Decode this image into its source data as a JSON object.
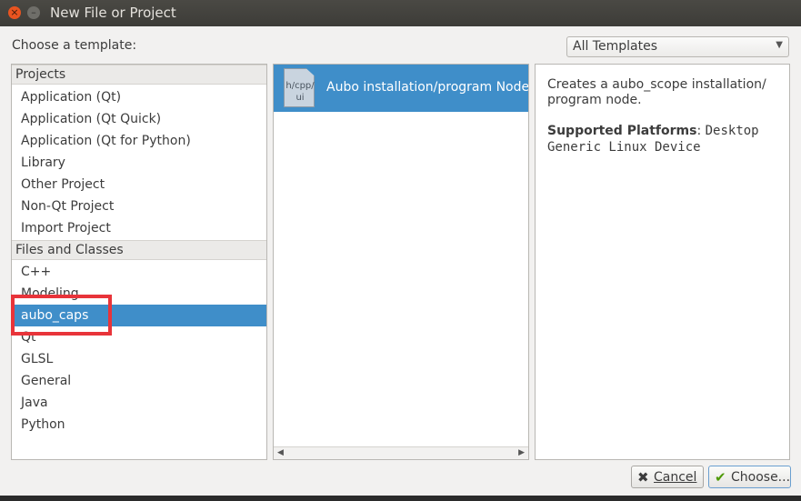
{
  "window": {
    "title": "New File or Project",
    "close_glyph": "×",
    "minimize_glyph": "–"
  },
  "header": {
    "choose_label": "Choose a template:",
    "filter_value": "All Templates"
  },
  "categories": {
    "groups": [
      {
        "header": "Projects",
        "items": [
          "Application (Qt)",
          "Application (Qt Quick)",
          "Application (Qt for Python)",
          "Library",
          "Other Project",
          "Non-Qt Project",
          "Import Project"
        ]
      },
      {
        "header": "Files and Classes",
        "items": [
          "C++",
          "Modeling",
          "aubo_caps",
          "Qt",
          "GLSL",
          "General",
          "Java",
          "Python"
        ]
      }
    ],
    "selected": "aubo_caps"
  },
  "templates": {
    "items": [
      {
        "icon_lines": [
          "h/cpp/",
          "ui"
        ],
        "label": "Aubo installation/program Node"
      }
    ]
  },
  "description": {
    "text": "Creates a aubo_scope installation/ program node.",
    "platforms_label": "Supported Platforms",
    "platforms_sep": ":",
    "platforms": [
      "Desktop",
      "Generic Linux Device"
    ]
  },
  "buttons": {
    "cancel_label": "Cancel",
    "choose_label": "Choose..."
  },
  "colors": {
    "selection": "#3f8ec9",
    "annotation_box": "#e8343a",
    "titlebar": "#3d3c38"
  }
}
